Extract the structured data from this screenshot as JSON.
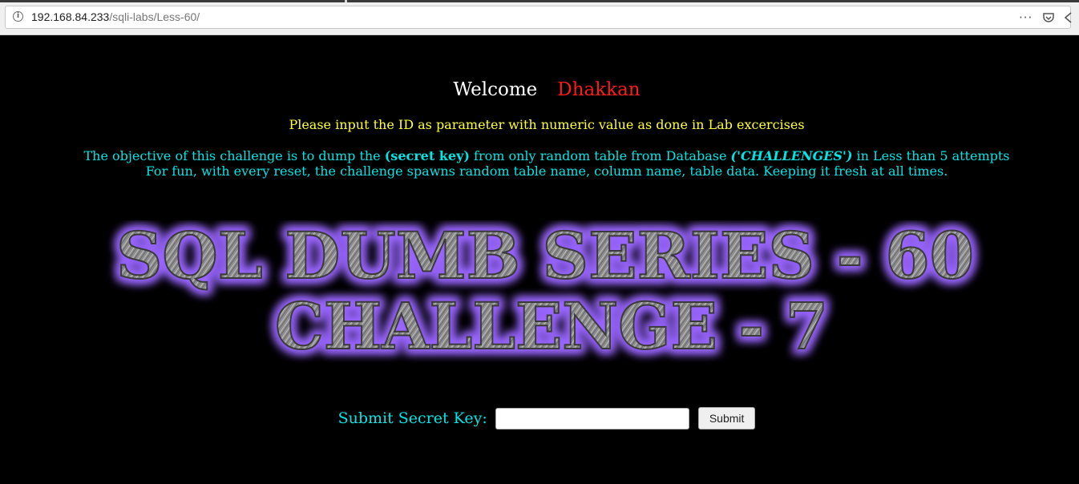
{
  "browser": {
    "url_host": "192.168.84.233",
    "url_path": "/sqli-labs/Less-60/",
    "icons": [
      "info-icon",
      "more-actions-icon",
      "pocket-icon",
      "chevron-icon"
    ]
  },
  "page": {
    "welcome": "Welcome",
    "user_name": "Dhakkan",
    "instruction": "Please input the ID as parameter with numeric value as done in Lab excercises",
    "objective_pre": "The objective of this challenge is to dump the ",
    "objective_key": "(secret key)",
    "objective_mid": " from only random table from Database ",
    "objective_db": "('CHALLENGES')",
    "objective_post": " in Less than 5 attempts",
    "fun_line": "For fun, with every reset, the challenge spawns random table name, column name, table data. Keeping it fresh at all times.",
    "banner_line1": "SQL DUMB SERIES - 60",
    "banner_line2": "CHALLENGE - 7",
    "submit_label": "Submit Secret Key:",
    "key_input_value": "",
    "submit_button": "Submit"
  },
  "colors": {
    "background": "#000000",
    "welcome": "#ffffff",
    "user_name": "#ff1a1a",
    "instruction": "#ffff33",
    "objective": "#00e5e5",
    "banner_glow": "#7a3cff",
    "banner_fill": "#9a9a9a"
  }
}
